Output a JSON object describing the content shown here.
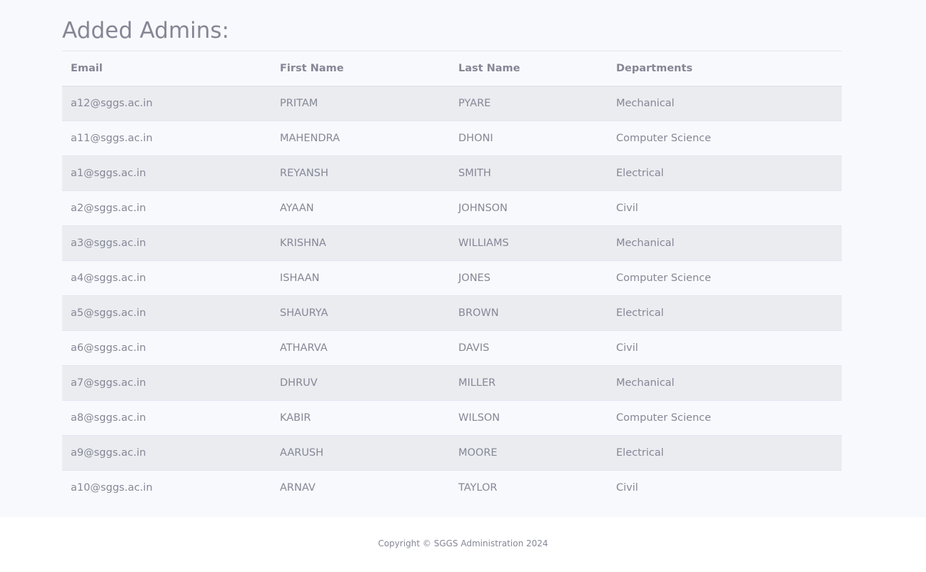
{
  "page": {
    "title": "Added Admins:"
  },
  "table": {
    "headers": {
      "email": "Email",
      "first_name": "First Name",
      "last_name": "Last Name",
      "departments": "Departments"
    },
    "rows": [
      {
        "email": "a12@sggs.ac.in",
        "first_name": "PRITAM",
        "last_name": "PYARE",
        "department": "Mechanical"
      },
      {
        "email": "a11@sggs.ac.in",
        "first_name": "MAHENDRA",
        "last_name": "DHONI",
        "department": "Computer Science"
      },
      {
        "email": "a1@sggs.ac.in",
        "first_name": "REYANSH",
        "last_name": "SMITH",
        "department": "Electrical"
      },
      {
        "email": "a2@sggs.ac.in",
        "first_name": "AYAAN",
        "last_name": "JOHNSON",
        "department": "Civil"
      },
      {
        "email": "a3@sggs.ac.in",
        "first_name": "KRISHNA",
        "last_name": "WILLIAMS",
        "department": "Mechanical"
      },
      {
        "email": "a4@sggs.ac.in",
        "first_name": "ISHAAN",
        "last_name": "JONES",
        "department": "Computer Science"
      },
      {
        "email": "a5@sggs.ac.in",
        "first_name": "SHAURYA",
        "last_name": "BROWN",
        "department": "Electrical"
      },
      {
        "email": "a6@sggs.ac.in",
        "first_name": "ATHARVA",
        "last_name": "DAVIS",
        "department": "Civil"
      },
      {
        "email": "a7@sggs.ac.in",
        "first_name": "DHRUV",
        "last_name": "MILLER",
        "department": "Mechanical"
      },
      {
        "email": "a8@sggs.ac.in",
        "first_name": "KABIR",
        "last_name": "WILSON",
        "department": "Computer Science"
      },
      {
        "email": "a9@sggs.ac.in",
        "first_name": "AARUSH",
        "last_name": "MOORE",
        "department": "Electrical"
      },
      {
        "email": "a10@sggs.ac.in",
        "first_name": "ARNAV",
        "last_name": "TAYLOR",
        "department": "Civil"
      }
    ]
  },
  "footer": {
    "copyright": "Copyright © SGGS Administration 2024"
  },
  "colors": {
    "text": "#858796",
    "page_bg": "#f8f9fc",
    "striped_row": "#eaecf0",
    "border": "#e3e6f0",
    "footer_bg": "#ffffff"
  }
}
